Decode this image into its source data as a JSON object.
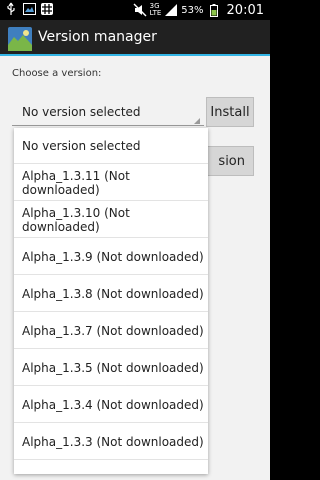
{
  "status_bar": {
    "time": "20:01",
    "battery_percent": "53%",
    "network_type": "3G",
    "network_sub": "LTE",
    "icons": [
      "usb-icon",
      "image-icon",
      "grid-icon",
      "mute-icon",
      "signal-icon",
      "battery-icon"
    ]
  },
  "action_bar": {
    "title": "Version manager",
    "accent_color": "#33b5e5"
  },
  "main": {
    "choose_label": "Choose a version:",
    "spinner_value": "No version selected",
    "install_label": "Install",
    "second_button_label": "sion"
  },
  "dropdown": {
    "items": [
      "No version selected",
      "Alpha_1.3.11 (Not downloaded)",
      "Alpha_1.3.10 (Not downloaded)",
      "Alpha_1.3.9 (Not downloaded)",
      "Alpha_1.3.8 (Not downloaded)",
      "Alpha_1.3.7 (Not downloaded)",
      "Alpha_1.3.5 (Not downloaded)",
      "Alpha_1.3.4 (Not downloaded)",
      "Alpha_1.3.3 (Not downloaded)"
    ]
  }
}
